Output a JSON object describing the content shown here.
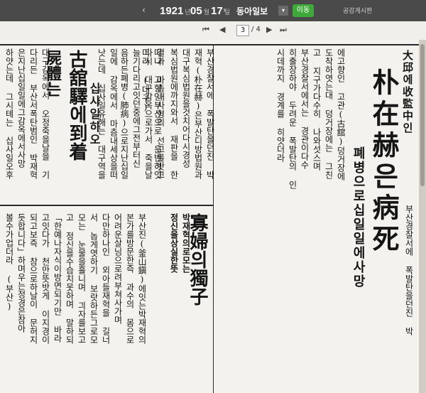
{
  "topbar": {
    "prev_arrow": "‹",
    "year": "1921",
    "year_unit": "년",
    "month": "05",
    "month_unit": "월",
    "day": "17",
    "day_unit": "일",
    "next_arrow": "›",
    "paper": "동아일보",
    "dropdown": "▾",
    "move_label": "이동",
    "board_link": "공감게시판"
  },
  "pager": {
    "first": "⏮",
    "prev": "◀",
    "current": "3",
    "total": "/ 4",
    "next": "▶",
    "last": "⏭"
  },
  "article": {
    "headline_small": "大邱에收監中인",
    "headline_big": "朴在赫은病死",
    "headline_sub": "폐병으로십일일에사망",
    "body_right": [
      "부산경찰서에 폭발탄을던진 박",
      "재혁(朴在赫)은부산디방법원과",
      "대구복심법원을것치어다시경성",
      "복심법원에까지와서 재판을 한",
      "결과 마츰내사형의 선고를밧고",
      "다시 대구감옥으로가서 죽을날",
      "늘기다리고잇던중에그전부터신",
      "음하든폐병(肺病)으로지난십일",
      "일에 감옥에서 마츰내세상을떠",
      "낫는데 십사일유해는 대구역을",
      "떠나 고향인부산으로 운반하얏",
      "더라 (대구)"
    ],
    "right_top_fragment": [
      "에고향인 고관(古舘)덩거장에",
      "도착하엿는대 덩거장에는 그친",
      "고 지구가다수히 나와섯스며",
      "부산경찰서에서는 경관이다수",
      "히출장하야 두려운 폭발탄의 인",
      "시데까지 경계를 히얏더라"
    ]
  },
  "article2": {
    "headline_a": "屍體는",
    "headline_b": "古舘驛에到着",
    "headline_c": "십사일하오",
    "body": [
      "대구감옥에서 오정죽을날을 기",
      "다리든 부산서폭탄범인 박재혁",
      "은지난십일일에그감옥에서사망",
      "하얏는데 그시톄는 십사일오후"
    ]
  },
  "article3": {
    "headline": "寡婦의獨子",
    "subhead": "박재혁의로모는",
    "subhead2": "정신을상실한뜻",
    "body": [
      "부산진(釜山鎭)에잇는박재혁의",
      "본가를방문한즉 과수의 몸으로",
      "어려운살님으로려부쳐사가며",
      "다만하나인 외아들재혁을 길너",
      "서 놉게엿하기 보랏하든그로모",
      "모는 눈물을흘니며 긔자를보고",
      "고 정신을수습치못하며 말하되",
      "「한예나자식이방면되기만 바라",
      "고잇다가 천만뜻밧게 이지경이",
      "되고보즉 참으로하날이 문허지",
      "듯합니다」하며우는정경은참아",
      "볼수가업더라 (부산)"
    ]
  }
}
